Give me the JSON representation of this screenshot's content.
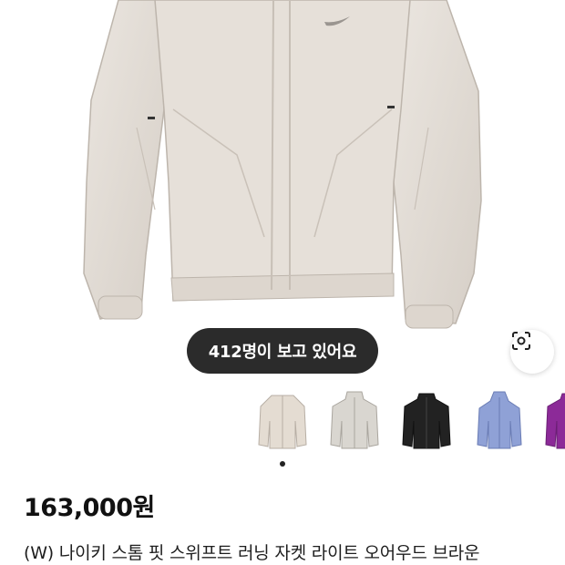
{
  "viewers": {
    "text": "412명이 보고 있어요"
  },
  "icons": {
    "lens": "camera-lens-search-icon",
    "nav_dot": "carousel-dot"
  },
  "colors": {
    "pill_bg": "#2b2b2b",
    "jacket_light": "#e3ddd6",
    "thumb_colors": [
      "#e4dcd2",
      "#d9d6d0",
      "#222222",
      "#8fa1d6",
      "#8c2a98"
    ]
  },
  "product": {
    "price": "163,000원",
    "title": "(W) 나이키 스톰 핏 스위프트 러닝 자켓 라이트 오어우드 브라운"
  }
}
